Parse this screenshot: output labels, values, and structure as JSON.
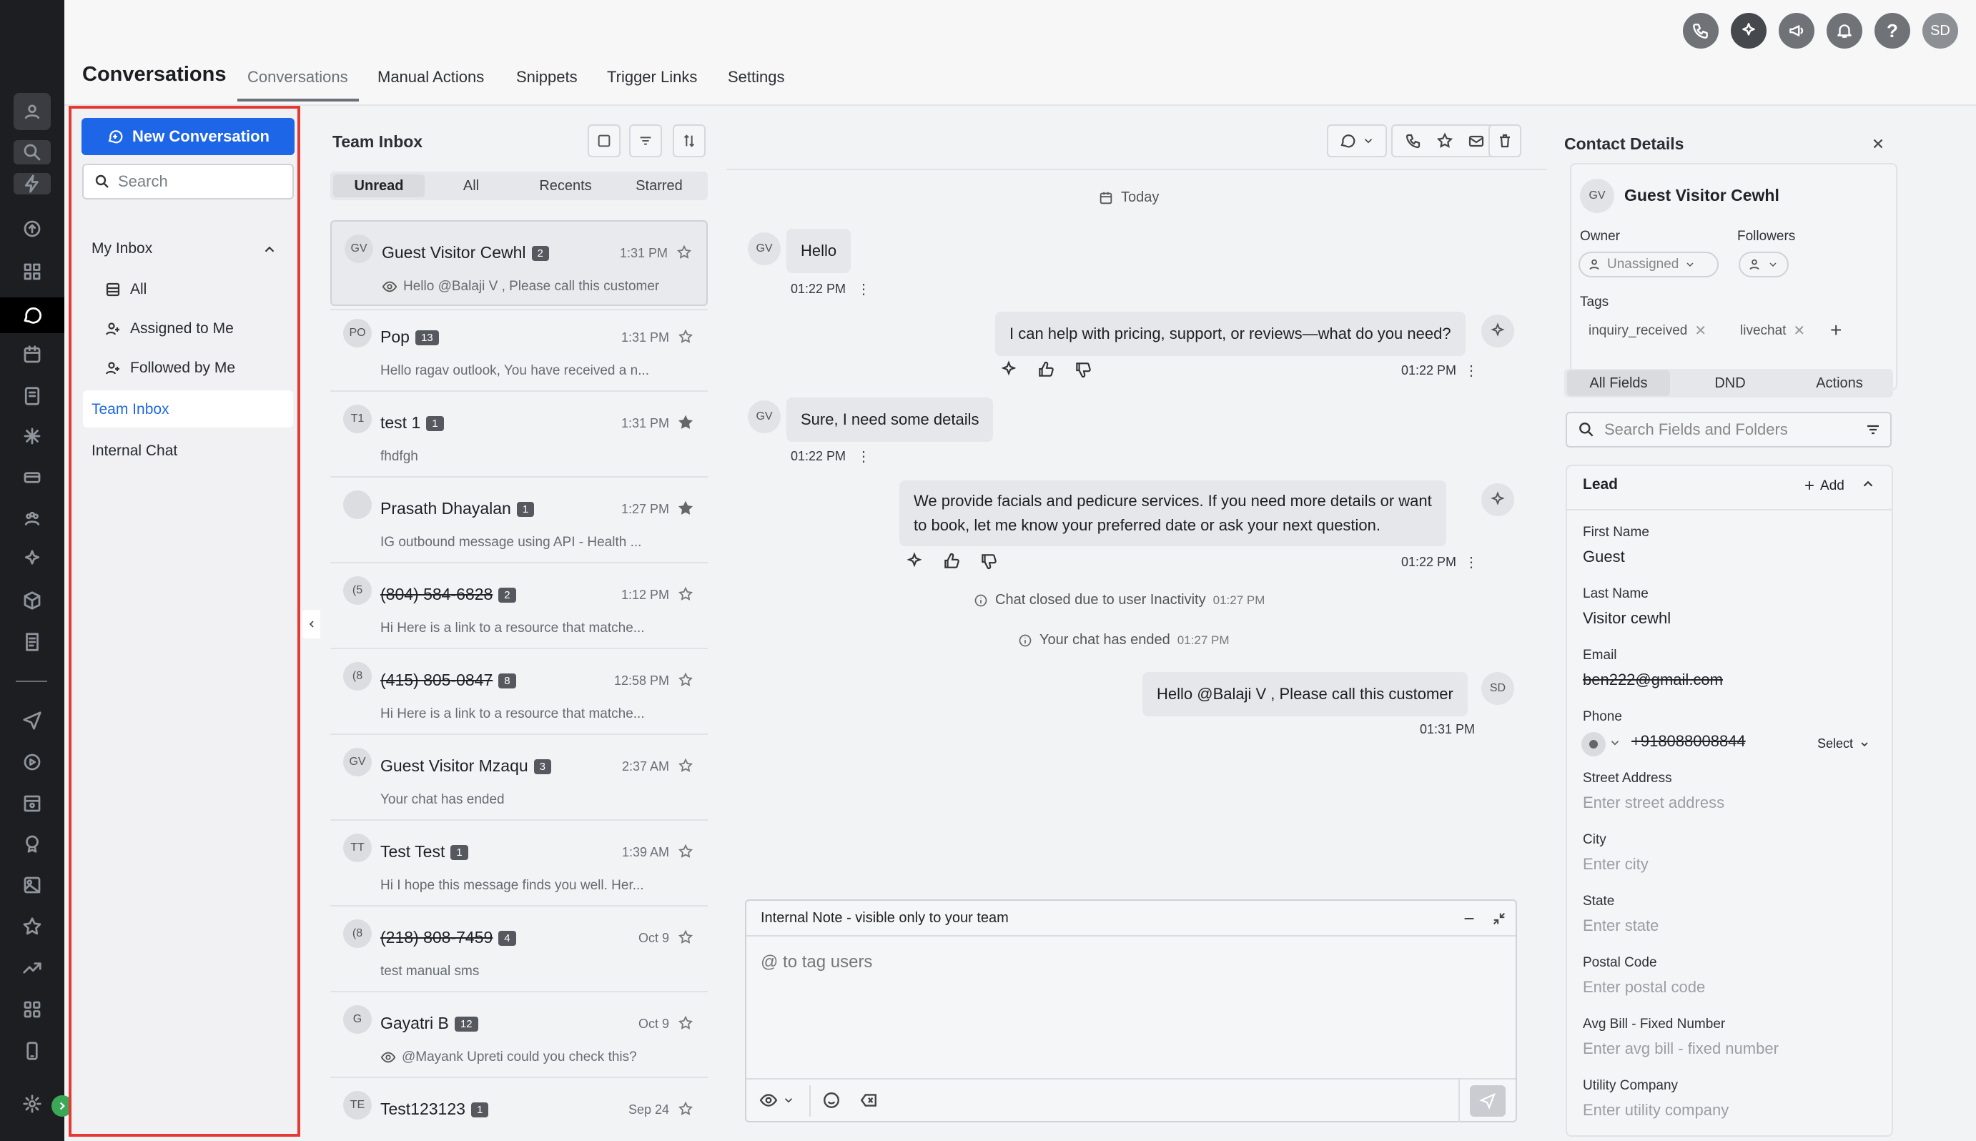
{
  "header": {
    "title": "Conversations",
    "tabs": [
      "Conversations",
      "Manual Actions",
      "Snippets",
      "Trigger Links",
      "Settings"
    ],
    "user_initials": "SD"
  },
  "nav": {
    "new_conversation": "New Conversation",
    "search_placeholder": "Search",
    "my_inbox": "My Inbox",
    "items": [
      "All",
      "Assigned to Me",
      "Followed by Me"
    ],
    "team_inbox": "Team Inbox",
    "internal_chat": "Internal Chat"
  },
  "list": {
    "title": "Team Inbox",
    "filters": [
      "Unread",
      "All",
      "Recents",
      "Starred"
    ],
    "conversations": [
      {
        "initials": "GV",
        "name": "Guest Visitor Cewhl",
        "count": "2",
        "time": "1:31 PM",
        "preview": "Hello @Balaji V , Please call this customer"
      },
      {
        "initials": "PO",
        "name": "Pop",
        "count": "13",
        "time": "1:31 PM",
        "preview": "Hello ragav outlook, You have received a n..."
      },
      {
        "initials": "T1",
        "name": "test 1",
        "count": "1",
        "time": "1:31 PM",
        "preview": "fhdfgh"
      },
      {
        "initials": "",
        "name": "Prasath Dhayalan",
        "count": "1",
        "time": "1:27 PM",
        "preview": "IG outbound message using API - Health ..."
      },
      {
        "initials": "(5",
        "name": "(804) 584-6828",
        "count": "2",
        "time": "1:12 PM",
        "preview": "Hi Here is a link to a resource that matche..."
      },
      {
        "initials": "(8",
        "name": "(415) 805-0847",
        "count": "8",
        "time": "12:58 PM",
        "preview": "Hi Here is a link to a resource that matche..."
      },
      {
        "initials": "GV",
        "name": "Guest Visitor Mzaqu",
        "count": "3",
        "time": "2:37 AM",
        "preview": "Your chat has ended"
      },
      {
        "initials": "TT",
        "name": "Test Test",
        "count": "1",
        "time": "1:39 AM",
        "preview": "Hi I hope this message finds you well. Her..."
      },
      {
        "initials": "(8",
        "name": "(218) 808-7459",
        "count": "4",
        "time": "Oct 9",
        "preview": "test manual sms"
      },
      {
        "initials": "G",
        "name": "Gayatri B",
        "count": "12",
        "time": "Oct 9",
        "preview": "@Mayank Upreti could you check this?"
      },
      {
        "initials": "TE",
        "name": "Test123123",
        "count": "1",
        "time": "Sep 24",
        "preview": ""
      }
    ]
  },
  "chat": {
    "today": "Today",
    "messages": [
      {
        "avatar": "GV",
        "text": "Hello",
        "time": "01:22 PM"
      },
      {
        "avatar": "",
        "text": "I can help with pricing, support, or reviews—what do you need?",
        "time": "01:22 PM"
      },
      {
        "avatar": "GV",
        "text": "Sure, I need some details",
        "time": "01:22 PM"
      },
      {
        "avatar": "",
        "text_line1": "We provide facials and pedicure services. If you need more details or want",
        "text_line2": "to book, let me know your preferred date or ask your next question.",
        "time": "01:22 PM"
      },
      {
        "avatar": "SD",
        "text": "Hello @Balaji V , Please call this customer",
        "time": "01:31 PM"
      }
    ],
    "system": [
      {
        "text": "Chat closed due to user Inactivity",
        "time": "01:27 PM"
      },
      {
        "text": "Your chat has ended",
        "time": "01:27 PM"
      }
    ],
    "composer_title": "Internal Note - visible only to your team",
    "composer_placeholder": "@ to tag users"
  },
  "contact": {
    "title": "Contact Details",
    "initials": "GV",
    "name": "Guest Visitor Cewhl",
    "owner_label": "Owner",
    "owner_value": "Unassigned",
    "followers_label": "Followers",
    "tags_label": "Tags",
    "tags": [
      "inquiry_received",
      "livechat"
    ],
    "tabs": [
      "All Fields",
      "DND",
      "Actions"
    ],
    "search_placeholder": "Search Fields and Folders",
    "section": "Lead",
    "add_label": "Add",
    "fields": [
      {
        "label": "First Name",
        "value": "Guest",
        "placeholder": ""
      },
      {
        "label": "Last Name",
        "value": "Visitor cewhl",
        "placeholder": ""
      },
      {
        "label": "Email",
        "value": "ben222@gmail.com",
        "placeholder": ""
      },
      {
        "label": "Phone",
        "value": "+918088008844",
        "placeholder": ""
      },
      {
        "label": "Street Address",
        "value": "",
        "placeholder": "Enter street address"
      },
      {
        "label": "City",
        "value": "",
        "placeholder": "Enter city"
      },
      {
        "label": "State",
        "value": "",
        "placeholder": "Enter state"
      },
      {
        "label": "Postal Code",
        "value": "",
        "placeholder": "Enter postal code"
      },
      {
        "label": "Avg Bill - Fixed Number",
        "value": "",
        "placeholder": "Enter avg bill - fixed number"
      },
      {
        "label": "Utility Company",
        "value": "",
        "placeholder": "Enter utility company"
      }
    ],
    "phone_select": "Select"
  }
}
